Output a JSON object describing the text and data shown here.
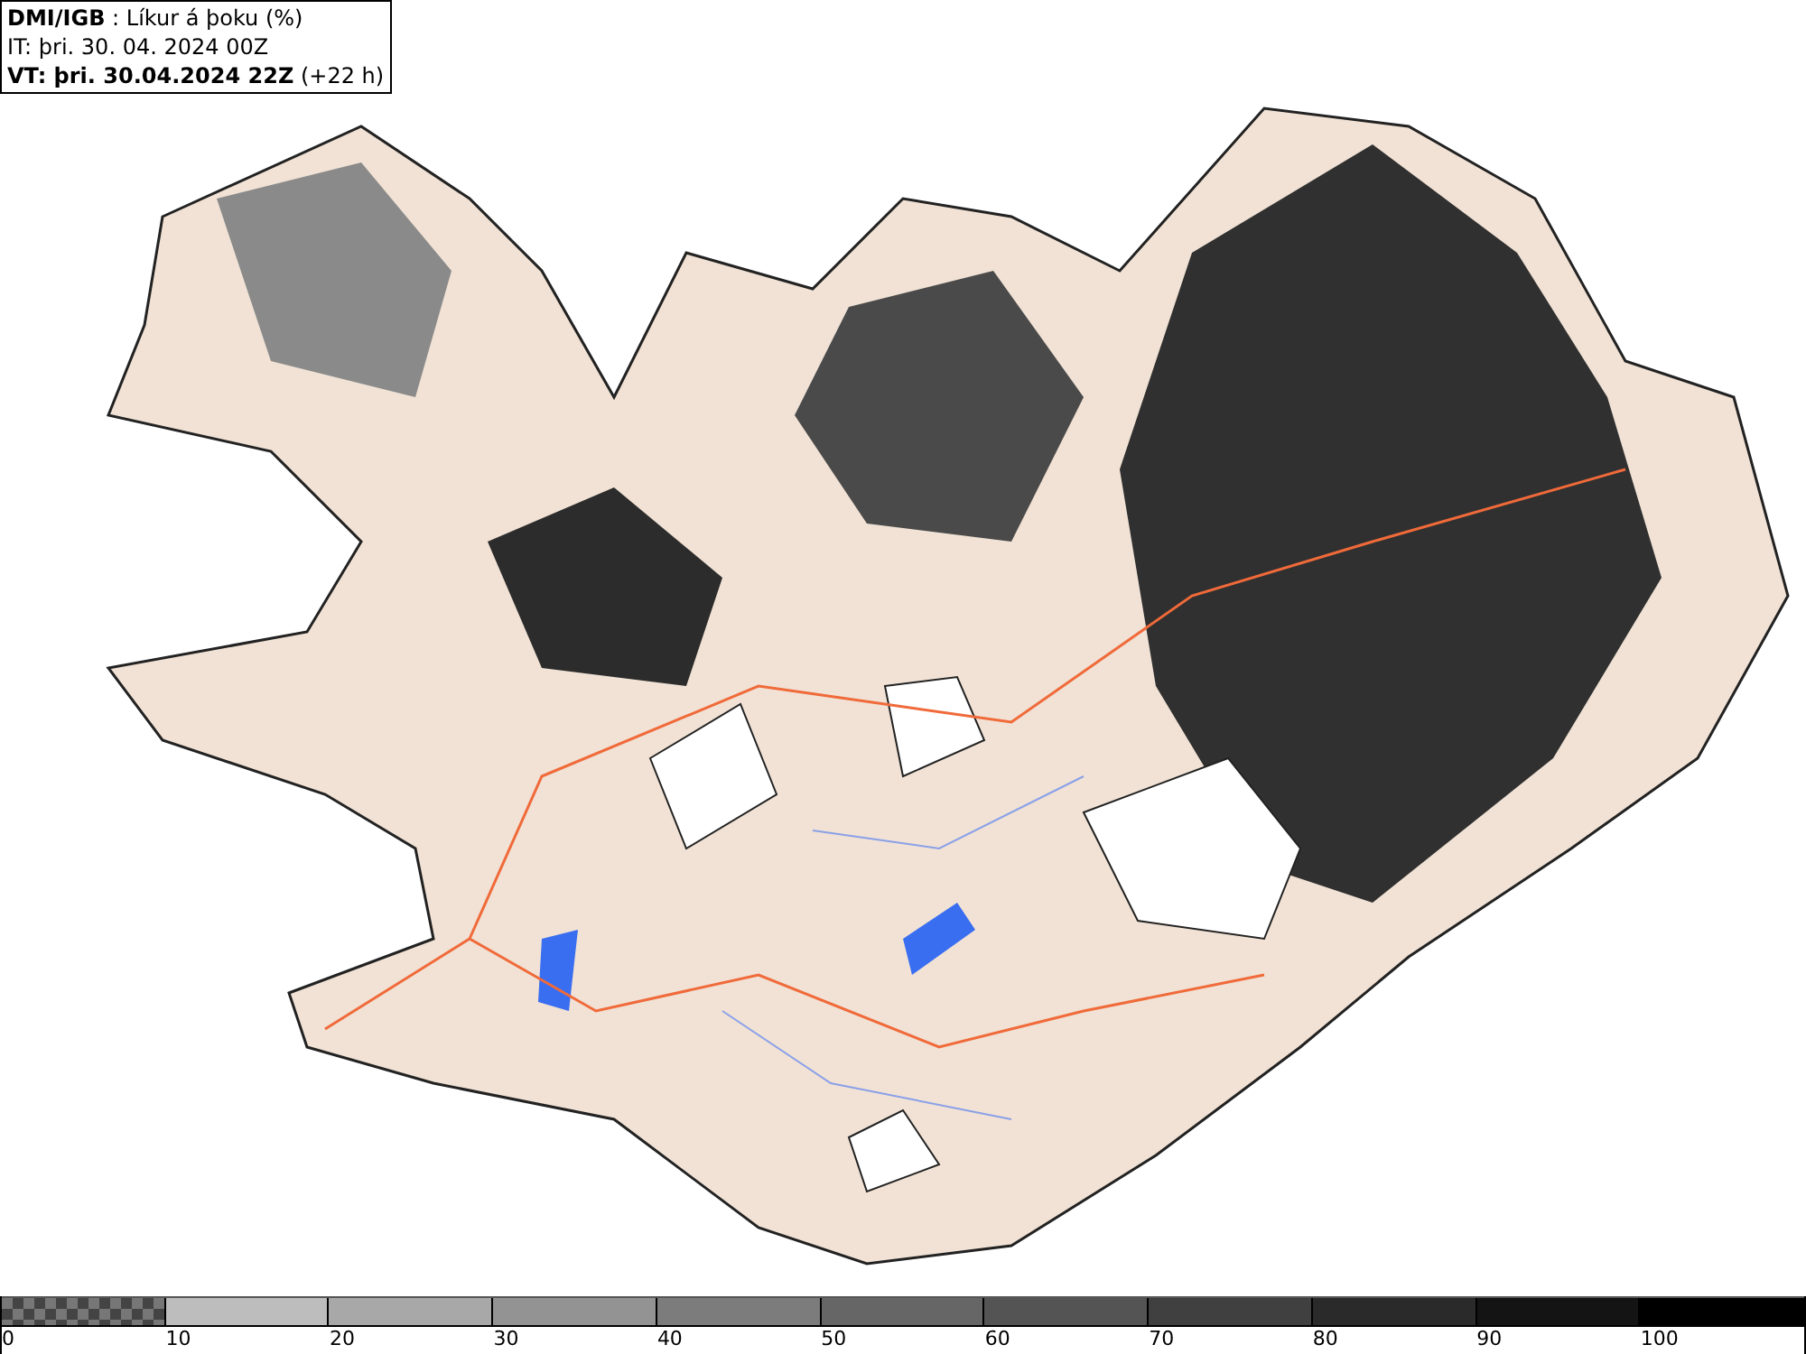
{
  "header": {
    "lines": [
      "**DMI/IGB** : Líkur á þoku (%)",
      "IT: þri. 30. 04. 2024 00Z",
      "**VT: þri. 30.04.2024 22Z** (+22 h)"
    ]
  },
  "legend": {
    "segments": [
      {
        "kind": "checker",
        "label": "0"
      },
      {
        "kind": "solid",
        "color": "#bdbdbd",
        "label": "10"
      },
      {
        "kind": "solid",
        "color": "#a8a8a8",
        "label": "20"
      },
      {
        "kind": "solid",
        "color": "#939393",
        "label": "30"
      },
      {
        "kind": "solid",
        "color": "#7c7c7c",
        "label": "40"
      },
      {
        "kind": "solid",
        "color": "#666666",
        "label": "50"
      },
      {
        "kind": "solid",
        "color": "#545454",
        "label": "60"
      },
      {
        "kind": "solid",
        "color": "#404040",
        "label": "70"
      },
      {
        "kind": "solid",
        "color": "#2a2a2a",
        "label": "80"
      },
      {
        "kind": "solid",
        "color": "#141414",
        "label": "90"
      },
      {
        "kind": "solid",
        "color": "#000000",
        "label": "100"
      }
    ]
  }
}
